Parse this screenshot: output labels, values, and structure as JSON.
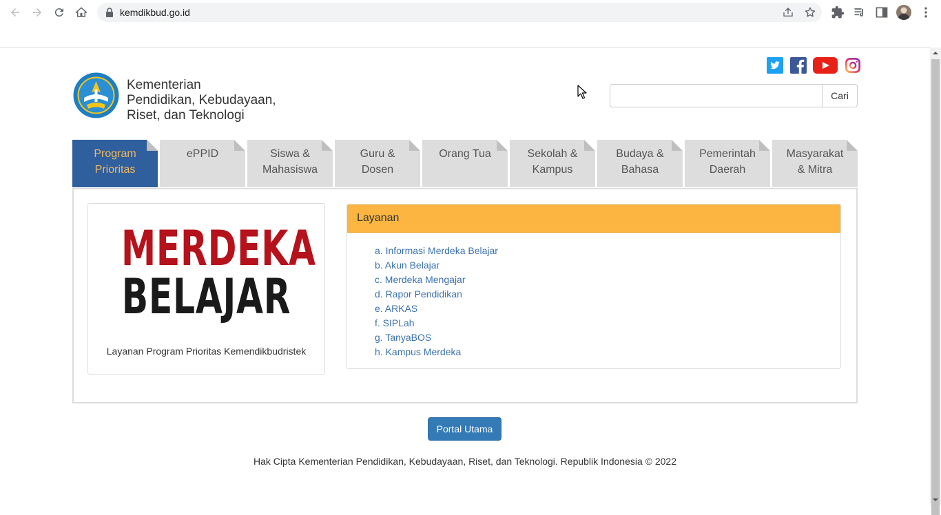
{
  "browser": {
    "url": "kemdikbud.go.id"
  },
  "header": {
    "org_line1": "Kementerian",
    "org_line2": "Pendidikan, Kebudayaan,",
    "org_line3": "Riset, dan Teknologi"
  },
  "search": {
    "placeholder": "",
    "button_label": "Cari"
  },
  "tabs": [
    {
      "line1": "Program",
      "line2": "Prioritas",
      "active": true
    },
    {
      "line1": "ePPID",
      "line2": ""
    },
    {
      "line1": "Siswa &",
      "line2": "Mahasiswa"
    },
    {
      "line1": "Guru &",
      "line2": "Dosen"
    },
    {
      "line1": "Orang Tua",
      "line2": ""
    },
    {
      "line1": "Sekolah &",
      "line2": "Kampus"
    },
    {
      "line1": "Budaya &",
      "line2": "Bahasa"
    },
    {
      "line1": "Pemerintah",
      "line2": "Daerah"
    },
    {
      "line1": "Masyarakat",
      "line2": "& Mitra"
    }
  ],
  "featured": {
    "word1": "MERDEKA",
    "word2": "BELAJAR",
    "caption": "Layanan Program Prioritas Kemendikbudristek"
  },
  "layanan": {
    "title": "Layanan",
    "items": [
      "a. Informasi Merdeka Belajar",
      "b. Akun Belajar",
      "c. Merdeka Mengajar",
      "d. Rapor Pendidikan",
      "e. ARKAS",
      "f. SIPLah",
      "g. TanyaBOS",
      "h. Kampus Merdeka"
    ]
  },
  "portal_button": "Portal Utama",
  "footer": "Hak Cipta Kementerian Pendidikan, Kebudayaan, Riset, dan Teknologi. Republik Indonesia © 2022",
  "colors": {
    "tab_active_bg": "#2f5f9c",
    "tab_active_text": "#f4b860",
    "panel_header": "#fbb540",
    "link": "#3a72b0",
    "primary_button": "#337ab7",
    "merdeka_red": "#b5121b"
  }
}
